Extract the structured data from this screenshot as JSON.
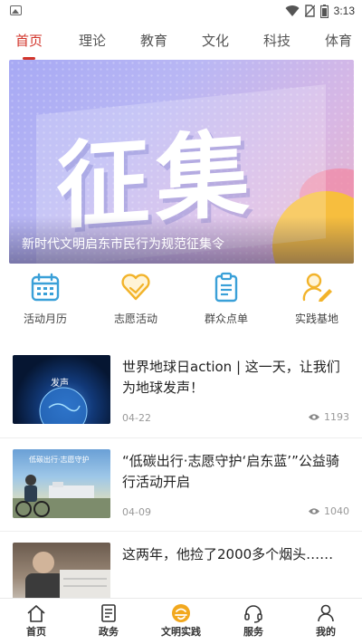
{
  "status_bar": {
    "time": "3:13",
    "icons": [
      "gallery-icon",
      "wifi-icon",
      "no-sim-icon",
      "battery-icon"
    ]
  },
  "tabs": [
    {
      "label": "首页",
      "active": true
    },
    {
      "label": "理论",
      "active": false
    },
    {
      "label": "教育",
      "active": false
    },
    {
      "label": "文化",
      "active": false
    },
    {
      "label": "科技",
      "active": false
    },
    {
      "label": "体育",
      "active": false
    }
  ],
  "banner": {
    "big_text": "征集",
    "caption": "新时代文明启东市民行为规范征集令"
  },
  "quick_access": [
    {
      "label": "活动月历",
      "icon": "calendar-icon",
      "color": "#3aa0d8"
    },
    {
      "label": "志愿活动",
      "icon": "heart-icon",
      "color": "#f2b32a"
    },
    {
      "label": "群众点单",
      "icon": "clipboard-icon",
      "color": "#3aa0d8"
    },
    {
      "label": "实践基地",
      "icon": "user-edit-icon",
      "color": "#f2b32a"
    }
  ],
  "news": [
    {
      "title": "世界地球日action | 这一天，让我们为地球发声！",
      "date": "04-22",
      "views": "1193"
    },
    {
      "title": "“低碳出行·志愿守护‘启东蓝’”公益骑行活动开启",
      "date": "04-09",
      "views": "1040"
    },
    {
      "title": "这两年，他捡了2000多个烟头……",
      "date": "",
      "views": ""
    }
  ],
  "thumb_texts": {
    "earth_voice": "发声",
    "cycling_banner": "低碳出行·志愿守护"
  },
  "bottom_nav": [
    {
      "label": "首页",
      "icon": "home-icon"
    },
    {
      "label": "政务",
      "icon": "document-icon"
    },
    {
      "label": "文明实践",
      "icon": "civilization-logo-icon"
    },
    {
      "label": "服务",
      "icon": "headset-icon"
    },
    {
      "label": "我的",
      "icon": "user-icon"
    }
  ],
  "colors": {
    "accent": "#d2352b",
    "blue": "#3aa0d8",
    "gold": "#f2b32a"
  }
}
